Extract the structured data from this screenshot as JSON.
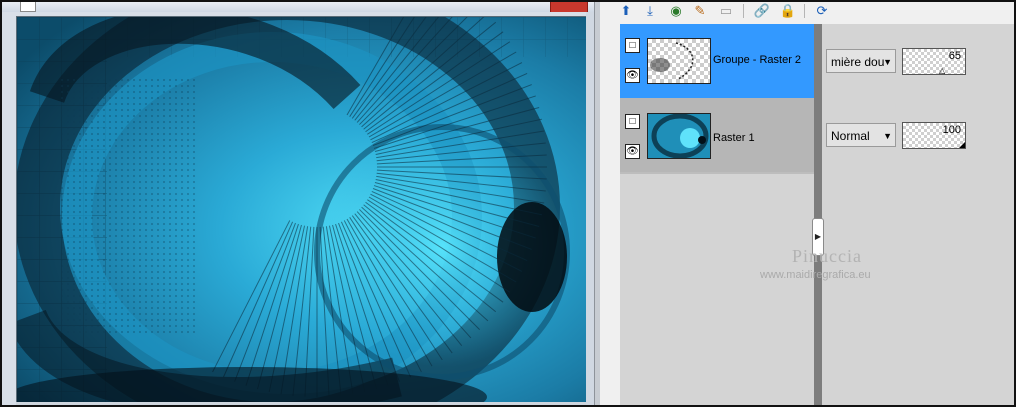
{
  "toolbar": {
    "icons": [
      "new-layer-icon",
      "merge-down-icon",
      "visibility-icon",
      "properties-icon",
      "delete-layer-icon",
      "link-icon",
      "lock-icon",
      "help-icon"
    ]
  },
  "layers": [
    {
      "name": "Groupe - Raster 2",
      "blend_mode": "mière dou",
      "opacity": "65",
      "opacity_level": 65,
      "selected": true
    },
    {
      "name": "Raster 1",
      "blend_mode": "Normal",
      "opacity": "100",
      "opacity_level": 100,
      "selected": false
    }
  ],
  "watermark": {
    "name": "Pinuccia",
    "site": "www.maidiregrafica.eu"
  },
  "colors": {
    "selected_row": "#3399ff",
    "canvas_blue": "#2a8fb6",
    "canvas_cyan": "#4ad4f4",
    "dark": "#05101a"
  }
}
